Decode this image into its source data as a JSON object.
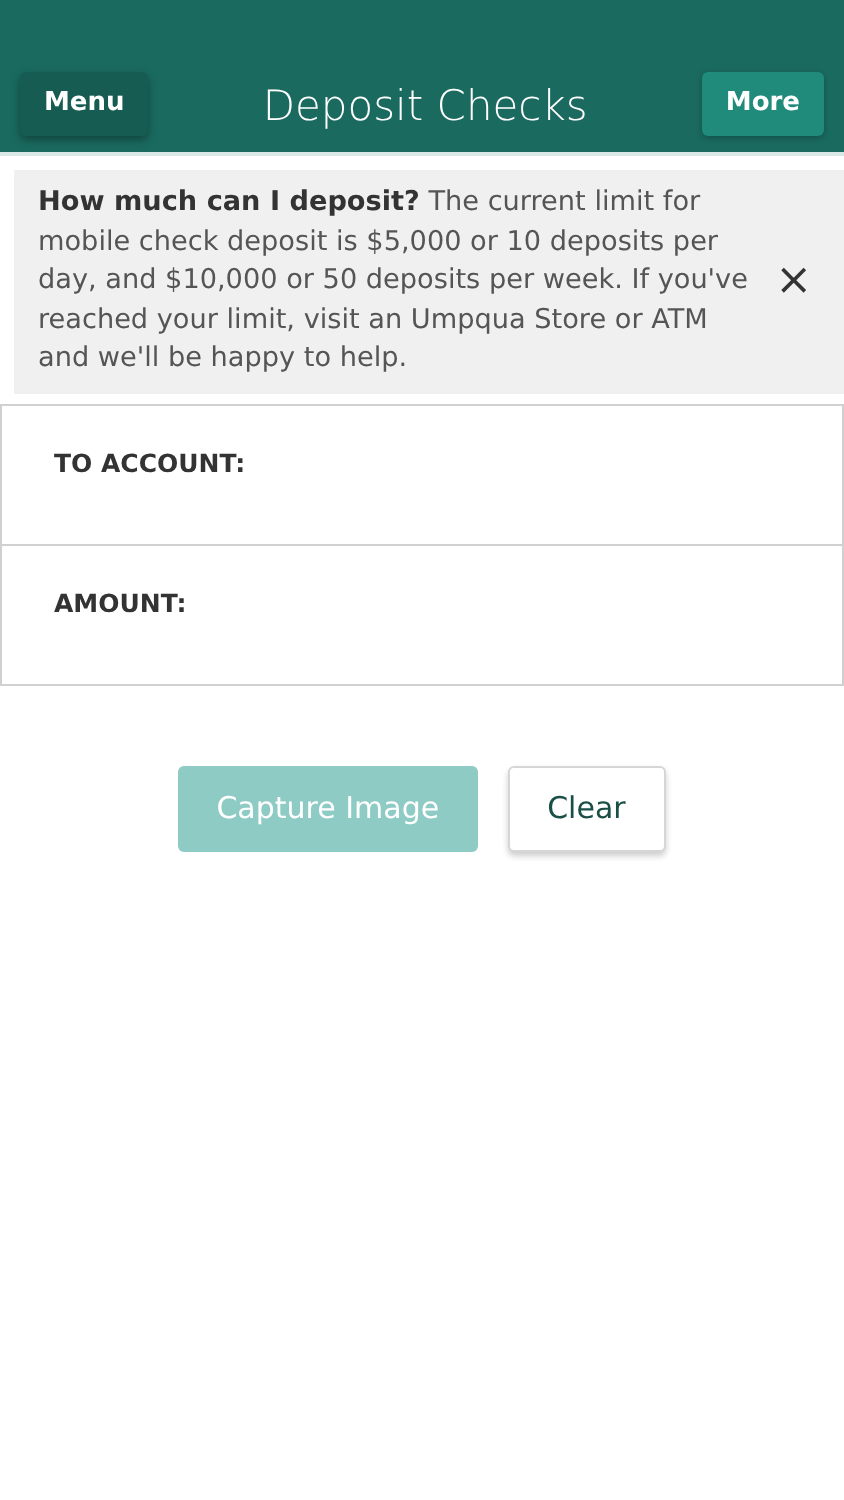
{
  "header": {
    "menu_button": "Menu",
    "title": "Deposit Checks",
    "more_button": "More"
  },
  "notice": {
    "text": "**How much can I deposit?** The current limit for mobile check deposit is $5,000 or 10 deposits per day, and $10,000 or 50 deposits per week. If you've reached your limit, visit an Umpqua Store or ATM and we'll be happy to help.",
    "close": "×"
  },
  "fields": [
    {
      "label": "TO ACCOUNT:"
    },
    {
      "label": "AMOUNT:"
    }
  ],
  "buttons": [
    {
      "label": "Capture Image",
      "kind": "primary",
      "disabled": true
    },
    {
      "label": "Clear",
      "kind": "secondary",
      "disabled": false
    }
  ]
}
